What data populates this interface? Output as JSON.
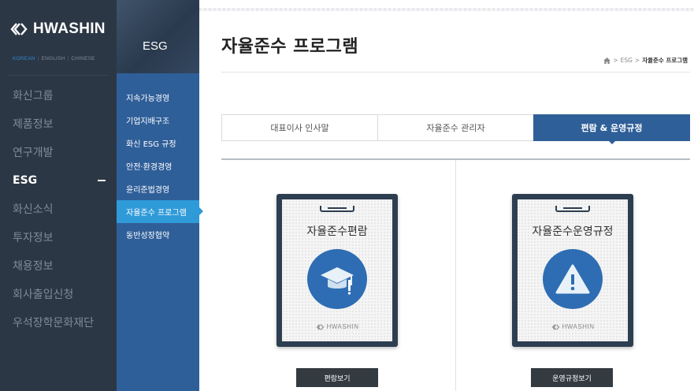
{
  "brand": {
    "name": "HWASHIN",
    "icon": "hwashin-logo-mark"
  },
  "languages": [
    "KOREAN",
    "ENGLISH",
    "CHINESE"
  ],
  "main_nav": {
    "items": [
      {
        "label": "화신그룹",
        "active": false
      },
      {
        "label": "제품정보",
        "active": false
      },
      {
        "label": "연구개발",
        "active": false
      },
      {
        "label": "ESG",
        "active": true
      },
      {
        "label": "화신소식",
        "active": false
      },
      {
        "label": "투자정보",
        "active": false
      },
      {
        "label": "채용정보",
        "active": false
      },
      {
        "label": "회사출입신청",
        "active": false
      },
      {
        "label": "우석장학문화재단",
        "active": false
      }
    ]
  },
  "sub_nav": {
    "title": "ESG",
    "items": [
      {
        "label": "지속가능경영",
        "active": false
      },
      {
        "label": "기업지배구조",
        "active": false
      },
      {
        "label": "화신 ESG 규정",
        "active": false
      },
      {
        "label": "안전·환경경영",
        "active": false
      },
      {
        "label": "윤리준법경영",
        "active": false
      },
      {
        "label": "자율준수 프로그램",
        "active": true
      },
      {
        "label": "동반성장협약",
        "active": false
      }
    ]
  },
  "page": {
    "title": "자율준수 프로그램",
    "breadcrumb": [
      "ESG",
      "자율준수 프로그램"
    ]
  },
  "tabs": [
    {
      "label": "대표이사 인사말",
      "active": false
    },
    {
      "label": "자율준수 관리자",
      "active": false
    },
    {
      "label": "편람 & 운영규정",
      "active": true
    }
  ],
  "cards": [
    {
      "title": "자율준수편람",
      "icon": "graduation-cap-icon",
      "brand": "HWASHIN",
      "button": "편람보기"
    },
    {
      "title": "자율준수운영규정",
      "icon": "warning-icon",
      "brand": "HWASHIN",
      "button": "운영규정보기"
    }
  ],
  "colors": {
    "nav_bg": "#2b3744",
    "subnav_bg": "#2f5f99",
    "accent": "#2f9ad8",
    "icon_circle": "#2e6db3",
    "button_bg": "#333a40"
  }
}
